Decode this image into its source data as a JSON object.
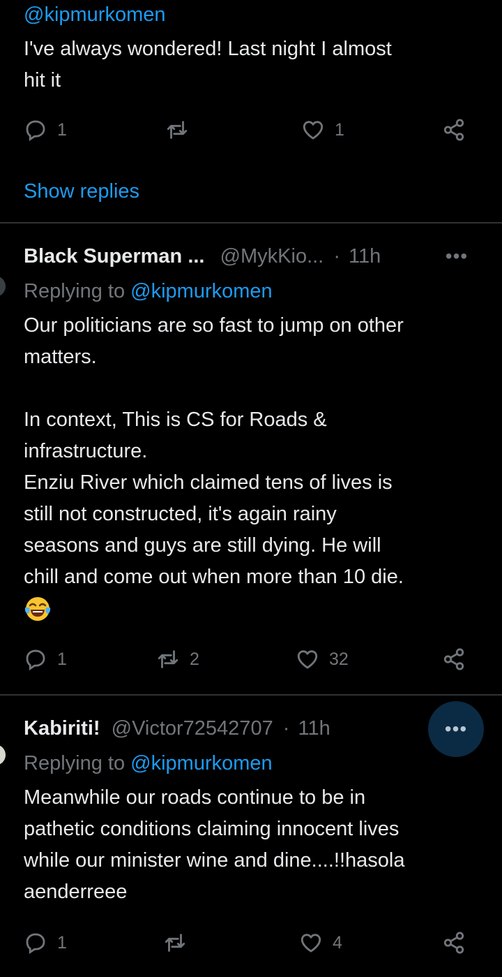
{
  "tweet1": {
    "mention": "@kipmurkomen",
    "text": "I've always wondered! Last night I almost\nhit it",
    "reply_count": "1",
    "retweet_count": "",
    "like_count": "1",
    "show_replies_label": "Show replies"
  },
  "tweet2": {
    "name": "Black Superman ...",
    "handle": "@MykKio...",
    "dot": "·",
    "time": "11h",
    "replying_prefix": "Replying to ",
    "replying_handle": "@kipmurkomen",
    "text": "Our politicians are so fast to jump on other\nmatters.\n\nIn context, This is CS for Roads &\ninfrastructure.\nEnziu River which claimed tens of lives is\nstill not constructed, it's again rainy\nseasons and guys are still dying. He will\nchill and come out when more than 10 die.",
    "emoji": "face-with-tears-of-joy",
    "reply_count": "1",
    "retweet_count": "2",
    "like_count": "32",
    "more_label": "•••"
  },
  "tweet3": {
    "name": "Kabiriti!",
    "handle": "@Victor72542707",
    "dot": "·",
    "time": "11h",
    "replying_prefix": "Replying to ",
    "replying_handle": "@kipmurkomen",
    "text": "Meanwhile our roads continue to be in\npathetic conditions claiming innocent lives\nwhile our minister wine and dine....!!hasola\naenderreee",
    "reply_count": "1",
    "retweet_count": "",
    "like_count": "4",
    "more_label": "•••"
  },
  "colors": {
    "background": "#000000",
    "text": "#e7e9ea",
    "secondary": "#71767b",
    "link": "#1d9bf0",
    "divider": "#2f3336"
  }
}
